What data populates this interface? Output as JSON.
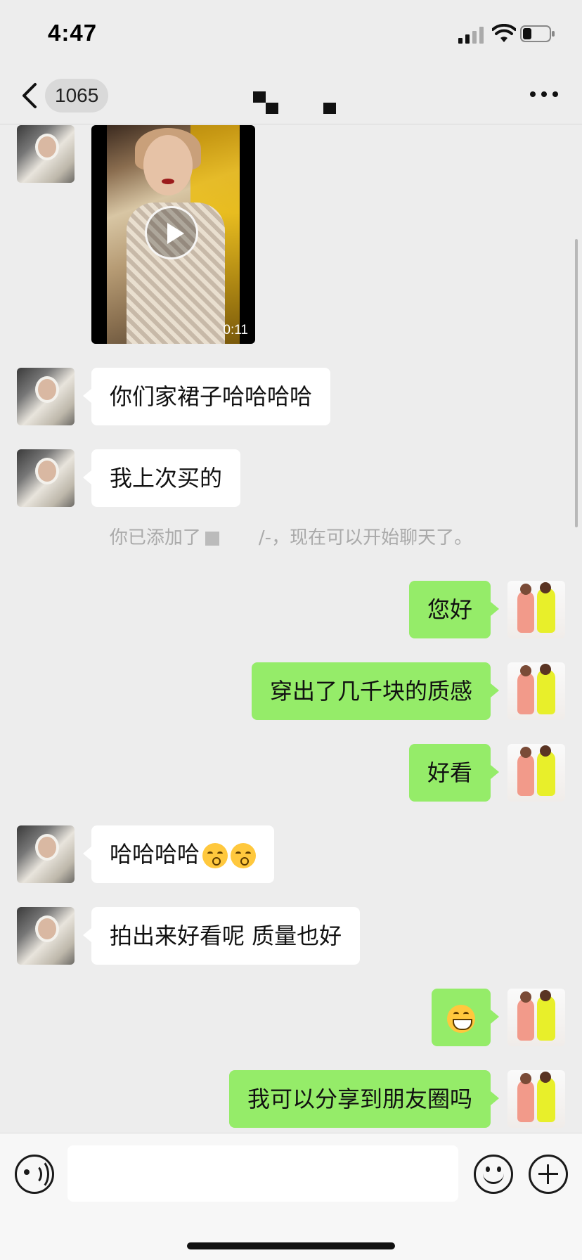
{
  "status_bar": {
    "time": "4:47"
  },
  "nav": {
    "unread_count": "1065",
    "icons": {
      "back": "chevron-left-icon",
      "more": "ellipsis-icon"
    }
  },
  "video": {
    "duration": "0:11"
  },
  "messages_in": [
    {
      "text": "你们家裙子哈哈哈哈"
    },
    {
      "text": "我上次买的"
    },
    {
      "text": "哈哈哈哈"
    },
    {
      "text": "拍出来好看呢 质量也好"
    }
  ],
  "system_notice": {
    "prefix": "你已添加了",
    "suffix": "/-，现在可以开始聊天了。"
  },
  "messages_out": [
    {
      "text": "您好"
    },
    {
      "text": "穿出了几千块的质感"
    },
    {
      "text": "好看"
    },
    {
      "text": ""
    },
    {
      "text": "我可以分享到朋友圈吗"
    }
  ],
  "emojis": {
    "kiss": "kissing-face-emoji",
    "grin": "grinning-face-emoji"
  },
  "input_bar": {
    "placeholder": ""
  },
  "colors": {
    "background": "#ededed",
    "outgoing_bubble": "#95ec69",
    "incoming_bubble": "#ffffff"
  }
}
